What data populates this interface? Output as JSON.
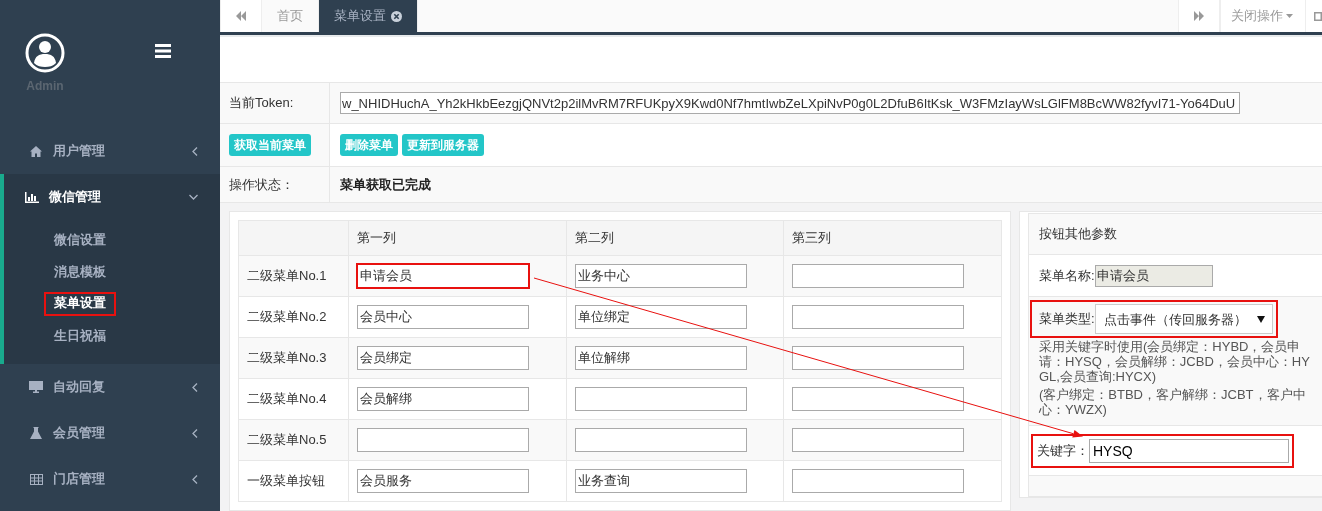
{
  "sidebar": {
    "user": "Admin",
    "items": [
      {
        "label": "用户管理",
        "expanded": false,
        "selected": false
      },
      {
        "label": "微信管理",
        "expanded": true,
        "selected": true,
        "children": [
          {
            "label": "微信设置",
            "selected": false,
            "highlighted": false
          },
          {
            "label": "消息模板",
            "selected": false,
            "highlighted": false
          },
          {
            "label": "菜单设置",
            "selected": true,
            "highlighted": true
          },
          {
            "label": "生日祝福",
            "selected": false,
            "highlighted": false
          }
        ]
      },
      {
        "label": "自动回复",
        "expanded": false,
        "selected": false
      },
      {
        "label": "会员管理",
        "expanded": false,
        "selected": false
      },
      {
        "label": "门店管理",
        "expanded": false,
        "selected": false
      }
    ]
  },
  "tab_bar": {
    "tabs": [
      {
        "label": "首页",
        "selected": false,
        "closable": false
      },
      {
        "label": "菜单设置",
        "selected": true,
        "closable": true
      }
    ],
    "close_menu": "关闭操作"
  },
  "form": {
    "token_label": "当前Token:",
    "token": "w_NHIDHuchA_Yh2kHkbEezgjQNVt2p2ilMvRM7RFUKpyX9Kwd0Nf7hmtIwbZeLXpiNvP0g0L2DfuB6ItKsk_W3FMzIayWsLGlFM8BcWW82fyvI71-Yo64DuU",
    "buttons": [
      "获取当前菜单",
      "删除菜单",
      "更新到服务器"
    ],
    "status_label": "操作状态：",
    "status": "菜单获取已完成"
  },
  "menu_grid": {
    "columns": [
      "第一列",
      "第二列",
      "第三列"
    ],
    "rows": [
      {
        "label": "二级菜单No.1",
        "cells": [
          {
            "value": "申请会员",
            "highlighted": true
          },
          {
            "value": "业务中心",
            "highlighted": false
          },
          {
            "highlighted": false
          }
        ]
      },
      {
        "label": "二级菜单No.2",
        "cells": [
          {
            "value": "会员中心",
            "highlighted": false
          },
          {
            "value": "单位绑定",
            "highlighted": false
          },
          {
            "highlighted": false
          }
        ]
      },
      {
        "label": "二级菜单No.3",
        "cells": [
          {
            "value": "会员绑定",
            "highlighted": false
          },
          {
            "value": "单位解绑",
            "highlighted": false
          },
          {
            "highlighted": false
          }
        ]
      },
      {
        "label": "二级菜单No.4",
        "cells": [
          {
            "value": "会员解绑",
            "highlighted": false
          },
          {
            "highlighted": false
          },
          {
            "highlighted": false
          }
        ]
      },
      {
        "label": "二级菜单No.5",
        "cells": [
          {
            "highlighted": false
          },
          {
            "highlighted": false
          },
          {
            "highlighted": false
          }
        ]
      },
      {
        "label": "一级菜单按钮",
        "cells": [
          {
            "value": "会员服务",
            "highlighted": false
          },
          {
            "value": "业务查询",
            "highlighted": false
          },
          {
            "highlighted": false
          }
        ]
      }
    ]
  },
  "params": {
    "title": "按钮其他参数",
    "name_label": "菜单名称:",
    "name": "申请会员",
    "type_label": "菜单类型:",
    "type": "点击事件（传回服务器）",
    "type_highlighted": true,
    "notes": [
      "采用关键字时使用(会员绑定：HYBD，会员申请：HYSQ，会员解绑：JCBD，会员中心：HYGL,会员查询:HYCX)",
      "(客户绑定：BTBD，客户解绑：JCBT，客户中心：YWZX)"
    ],
    "keyword_label": "关键字：",
    "keyword": "HYSQ",
    "keyword_highlighted": true
  },
  "annotation_arrow": true
}
